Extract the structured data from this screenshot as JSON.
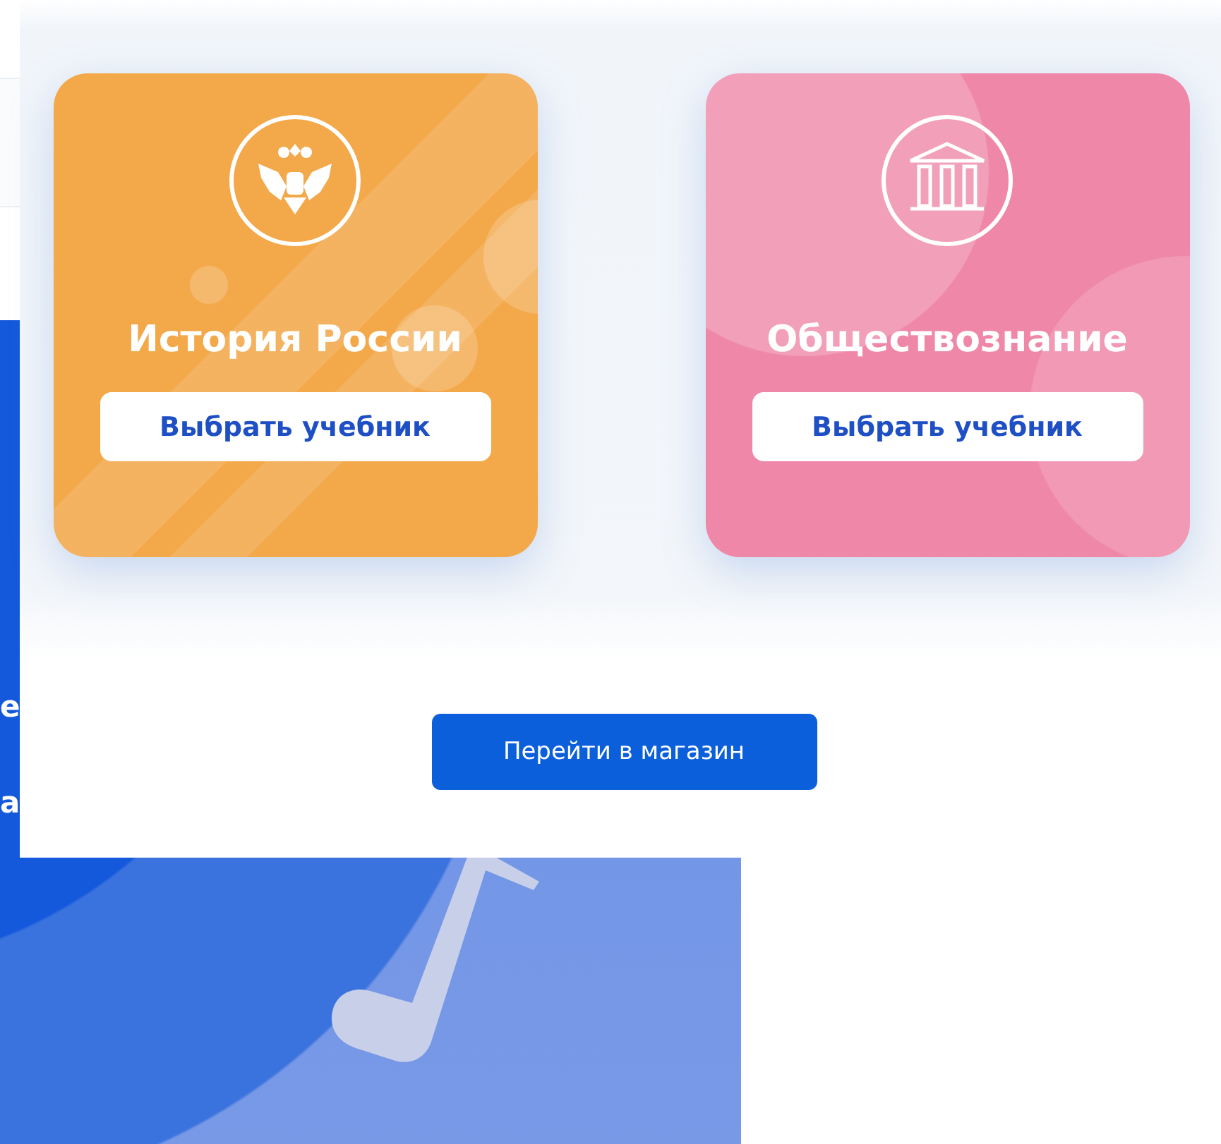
{
  "background_page": {
    "cut_texts": [
      "е",
      "а"
    ]
  },
  "subjects": [
    {
      "title": "История России",
      "button": "Выбрать учебник",
      "kind": "emblem",
      "color": "#f3a84a"
    },
    {
      "title": "Обществознание",
      "button": "Выбрать учебник",
      "kind": "building",
      "color": "#ef87a8"
    }
  ],
  "shop_button": "Перейти в магазин"
}
